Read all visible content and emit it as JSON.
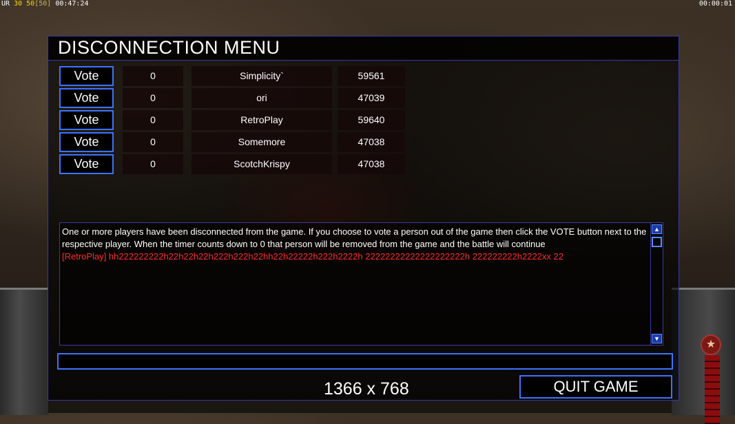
{
  "hud": {
    "ur_label": "UR",
    "fps": "30",
    "fps_cap_value": "50",
    "fps_cap": "[50]",
    "game_time": "00:47:24",
    "countdown": "00:00:01"
  },
  "dialog": {
    "title": "DISCONNECTION MENU",
    "vote_label": "Vote",
    "players": [
      {
        "votes": "0",
        "name": "Simplicity`",
        "ping": "59561"
      },
      {
        "votes": "0",
        "name": "ori",
        "ping": "47039"
      },
      {
        "votes": "0",
        "name": "RetroPlay",
        "ping": "59640"
      },
      {
        "votes": "0",
        "name": "Somemore",
        "ping": "47038"
      },
      {
        "votes": "0",
        "name": "ScotchKrispy",
        "ping": "47038"
      }
    ],
    "chat": {
      "system_message": "One or more players have been disconnected from the game. If you choose to vote a person out of the game then click the VOTE button next to the respective player. When the timer counts down to 0 that person will be removed from the game and the battle will continue",
      "player_message": "[RetroPlay] hh222222222h22h22h22h222h222h22hh22h22222h222h2222h 22222222222222222222h 222222222h2222xx 22"
    },
    "chat_input_value": "",
    "resolution_text": "1366 x 768",
    "quit_label": "QUIT GAME"
  },
  "colors": {
    "accent_border": "#3c74ff",
    "chat_player_text": "#ff2a2a",
    "fps_color": "#ffd700"
  },
  "icons": {
    "scroll_up": "scroll-up-arrow-icon",
    "scroll_down": "scroll-down-arrow-icon",
    "faction_star": "star-icon"
  }
}
